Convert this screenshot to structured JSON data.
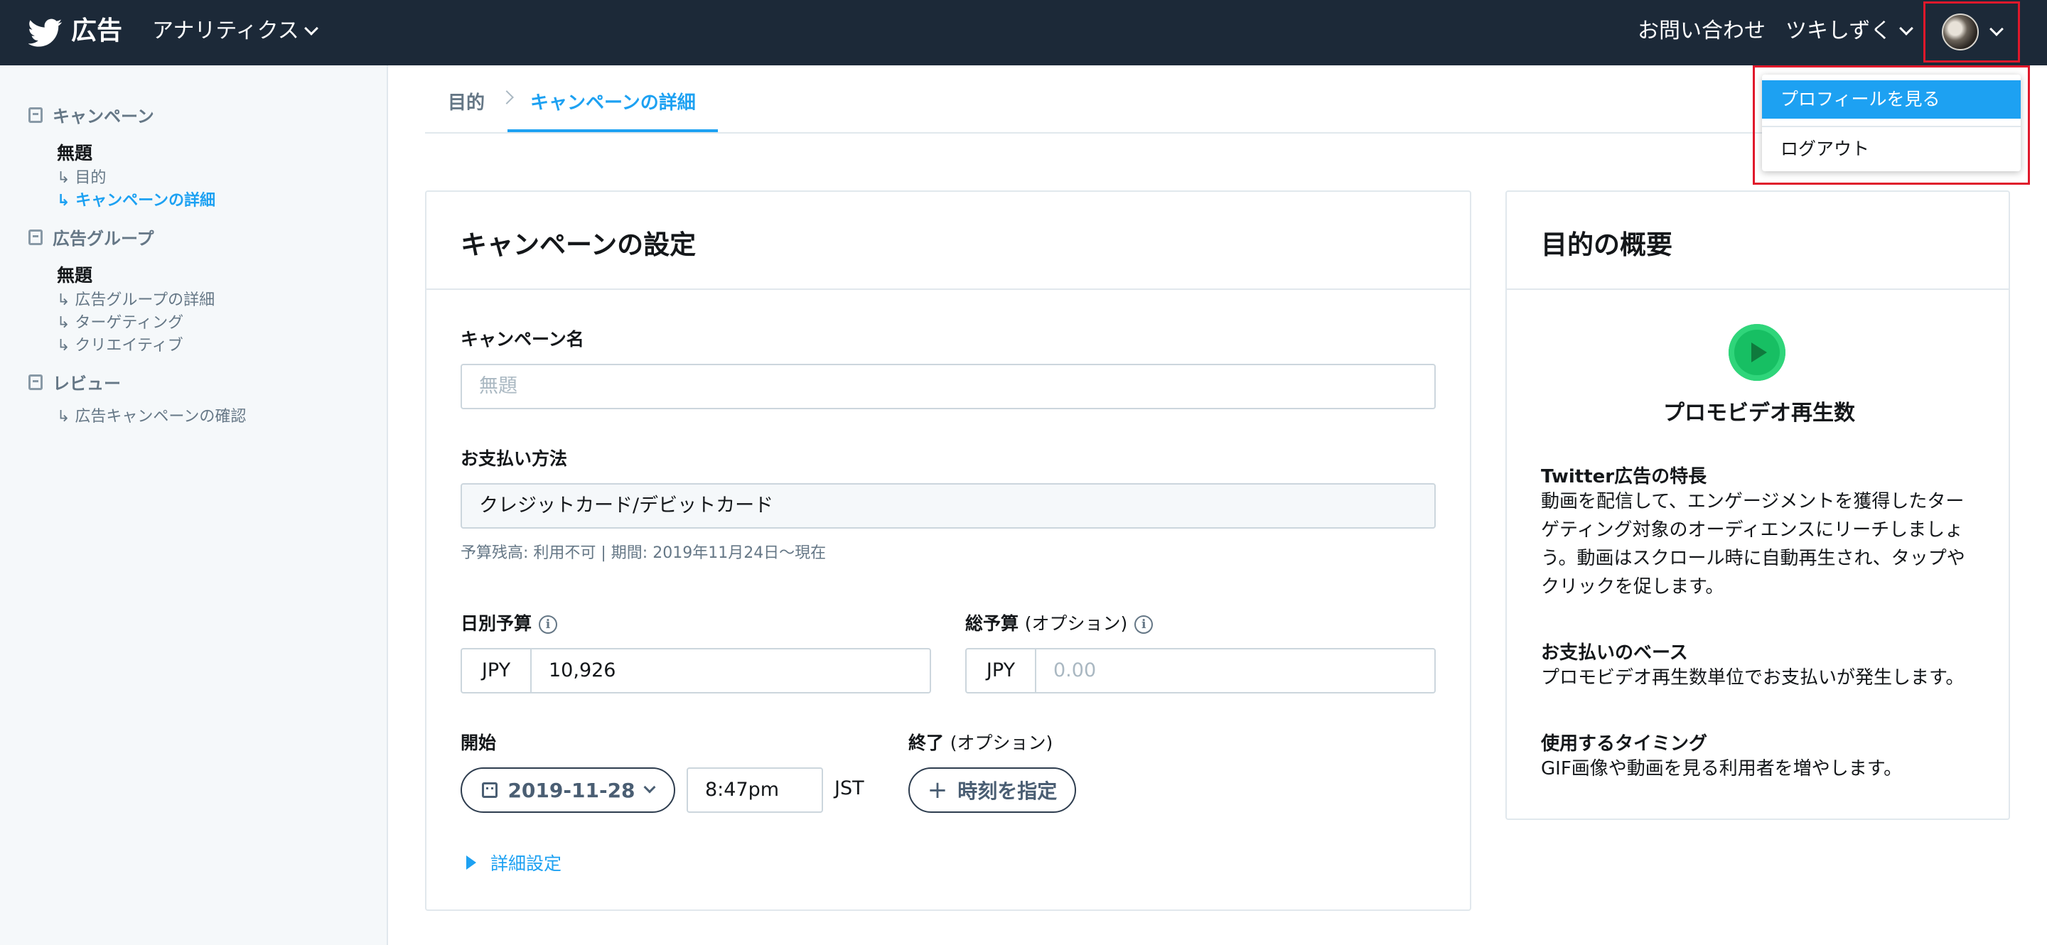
{
  "nav": {
    "brand": "広告",
    "analytics": "アナリティクス",
    "contact": "お問い合わせ",
    "username": "ツキしずく"
  },
  "dropdown": {
    "items": [
      "プロフィールを見る",
      "ログアウト"
    ]
  },
  "sidebar": {
    "campaign": {
      "heading": "キャンペーン",
      "title": "無題",
      "items": [
        "↳ 目的",
        "↳ キャンペーンの詳細"
      ]
    },
    "adgroup": {
      "heading": "広告グループ",
      "title": "無題",
      "items": [
        "↳ 広告グループの詳細",
        "↳ ターゲティング",
        "↳ クリエイティブ"
      ]
    },
    "review": {
      "heading": "レビュー",
      "items": [
        "↳ 広告キャンペーンの確認"
      ]
    }
  },
  "tabs": [
    "目的",
    "キャンペーンの詳細"
  ],
  "settings": {
    "title": "キャンペーンの設定",
    "name_label": "キャンペーン名",
    "name_placeholder": "無題",
    "payment_label": "お支払い方法",
    "payment_value": "クレジットカード/デビットカード",
    "payment_hint": "予算残高: 利用不可 | 期間: 2019年11月24日〜現在",
    "daily_label": "日別予算",
    "currency": "JPY",
    "daily_value": "10,926",
    "total_label": "総予算",
    "total_opt": "(オプション)",
    "total_placeholder": "0.00",
    "start_label": "開始",
    "start_date": "2019-11-28",
    "start_time": "8:47pm",
    "timezone": "JST",
    "end_label": "終了",
    "end_opt": "(オプション)",
    "set_time": "時刻を指定",
    "advanced": "詳細設定"
  },
  "objective": {
    "title": "目的の概要",
    "name": "プロモビデオ再生数",
    "sections": [
      {
        "heading": "Twitter広告の特長",
        "text": "動画を配信して、エンゲージメントを獲得したターゲティング対象のオーディエンスにリーチしましょう。動画はスクロール時に自動再生され、タップやクリックを促します。"
      },
      {
        "heading": "お支払いのベース",
        "text": "プロモビデオ再生数単位でお支払いが発生します。"
      },
      {
        "heading": "使用するタイミング",
        "text": "GIF画像や動画を見る利用者を増やします。"
      }
    ]
  },
  "colors": {
    "nav_bg": "#1c2938",
    "accent": "#1da1f2",
    "highlight_box": "#e0182b",
    "objective_icon": "#17bf63"
  }
}
